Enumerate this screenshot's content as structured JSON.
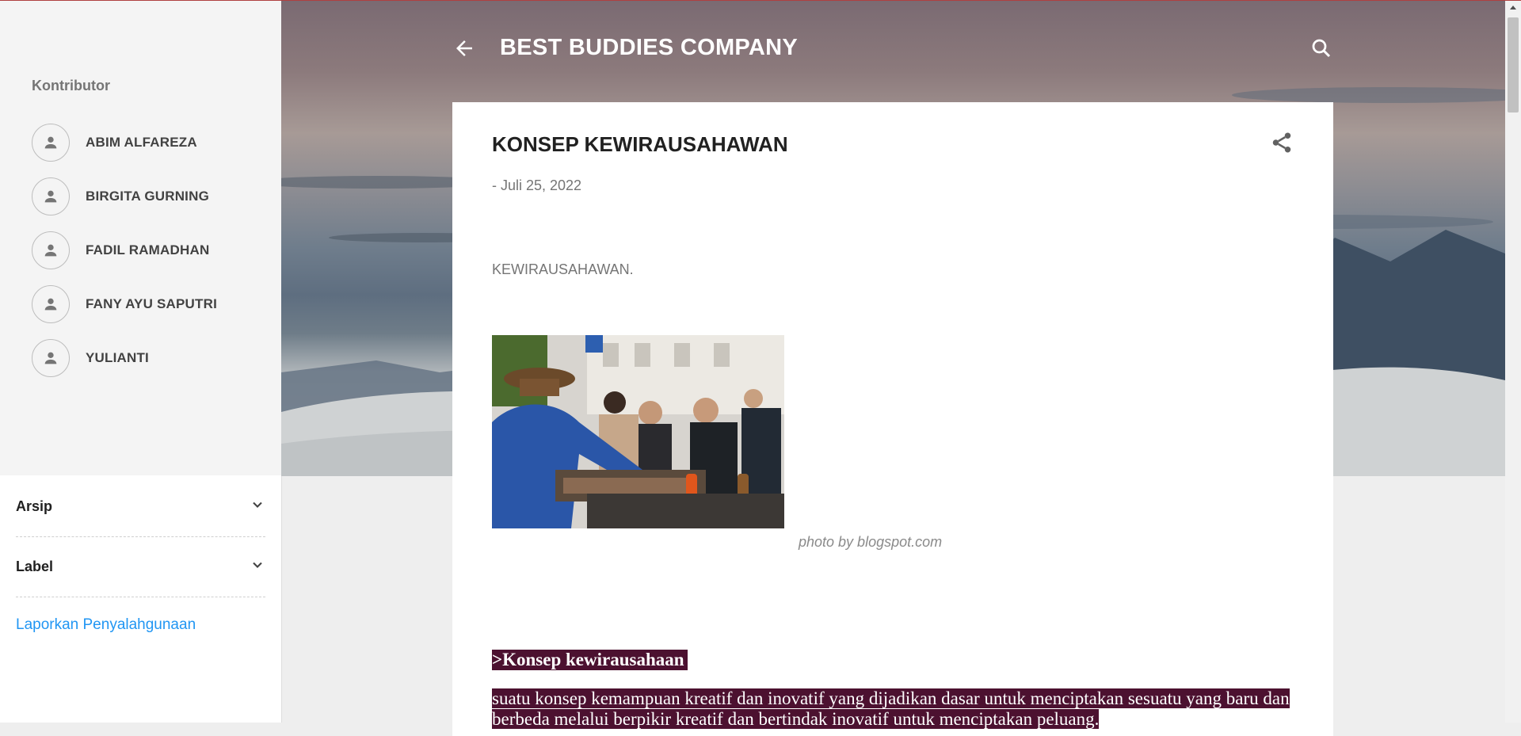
{
  "header": {
    "blog_title": "BEST BUDDIES COMPANY"
  },
  "sidebar": {
    "contributors_title": "Kontributor",
    "contributors": [
      {
        "name": "ABIM ALFAREZA"
      },
      {
        "name": "BIRGITA GURNING"
      },
      {
        "name": "FADIL RAMADHAN"
      },
      {
        "name": "FANY AYU SAPUTRI"
      },
      {
        "name": "YULIANTI"
      }
    ],
    "archive_label": "Arsip",
    "label_label": "Label",
    "report_link": "Laporkan Penyalahgunaan"
  },
  "post": {
    "title": "KONSEP KEWIRAUSAHAWAN",
    "date": "- Juli 25, 2022",
    "lead": "KEWIRAUSAHAWAN.",
    "photo_caption": "photo by blogspot.com",
    "heading": ">Konsep kewirausahaan",
    "body": "suatu konsep kemampuan kreatif dan inovatif yang dijadikan dasar untuk menciptakan sesuatu yang baru dan berbeda melalui berpikir kreatif dan bertindak inovatif untuk menciptakan peluang."
  },
  "colors": {
    "link": "#2196f3",
    "highlight_bg": "#4c1130"
  }
}
